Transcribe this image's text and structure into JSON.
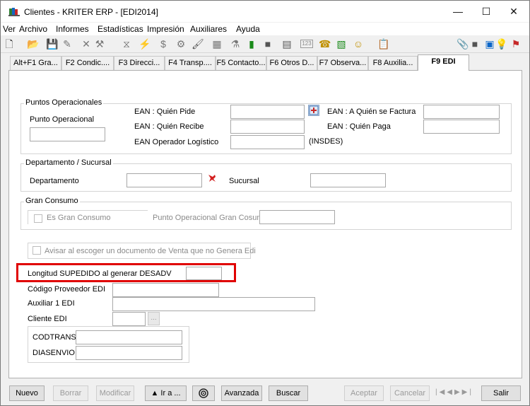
{
  "window": {
    "title": "Clientes - KRITER ERP - [EDI2014]",
    "min_glyph": "—",
    "max_glyph": "☐",
    "close_glyph": "✕"
  },
  "menu": [
    "Ver",
    "Archivo",
    "Informes",
    "Estadísticas",
    "Impresión",
    "Auxiliares",
    "Ayuda"
  ],
  "toolbar_icons": [
    {
      "name": "new-doc-icon",
      "glyph": "🗋"
    },
    {
      "name": "open-folder-icon",
      "glyph": "📂"
    },
    {
      "name": "save-icon",
      "glyph": "💾"
    },
    {
      "name": "edit-icon",
      "glyph": "✎"
    },
    {
      "name": "delete-x-icon",
      "glyph": "✕"
    },
    {
      "name": "hammer-icon",
      "glyph": "⚒"
    },
    {
      "name": "funnel-icon",
      "glyph": "⧖"
    },
    {
      "name": "wand-icon",
      "glyph": "⚡"
    },
    {
      "name": "dollar-icon",
      "glyph": "$"
    },
    {
      "name": "gear-icon",
      "glyph": "⚙"
    },
    {
      "name": "brush-icon",
      "glyph": "🖌"
    },
    {
      "name": "grid-icon",
      "glyph": "▦"
    },
    {
      "name": "filter-icon",
      "glyph": "⚗"
    },
    {
      "name": "bar-chart-icon",
      "glyph": "▮"
    },
    {
      "name": "dark-square-icon",
      "glyph": "■"
    },
    {
      "name": "calculator-icon",
      "glyph": "▤"
    },
    {
      "name": "counter-123-icon",
      "glyph": "123"
    },
    {
      "name": "phone-icon",
      "glyph": "☎"
    },
    {
      "name": "excel-icon",
      "glyph": "▧"
    },
    {
      "name": "smiley-icon",
      "glyph": "☺"
    },
    {
      "name": "clipboard-icon",
      "glyph": "📋"
    },
    {
      "name": "paperclip-icon",
      "glyph": "📎"
    },
    {
      "name": "blue-square-icon",
      "glyph": "■"
    },
    {
      "name": "layout-icon",
      "glyph": "▣"
    },
    {
      "name": "lightbulb-icon",
      "glyph": "💡"
    },
    {
      "name": "lock-icon",
      "glyph": "⚑"
    }
  ],
  "tabs": [
    "Alt+F1 Gra...",
    "F2 Condic....",
    "F3 Direcci...",
    "F4 Transp....",
    "F5 Contacto...",
    "F6 Otros D...",
    "F7 Observa...",
    "F8 Auxilia...",
    "F9 EDI"
  ],
  "puntos": {
    "group_title": "Puntos Operacionales",
    "punto_operacional_label": "Punto Operacional",
    "punto_operacional_value": "",
    "ean_pide_label": "EAN : Quién Pide",
    "ean_pide_value": "",
    "ean_recibe_label": "EAN : Quién Recibe",
    "ean_recibe_value": "",
    "ean_logistico_label": "EAN Operador Logístico",
    "ean_logistico_value": "",
    "insdes_label": "(INSDES)",
    "ean_factura_label": "EAN : A Quién se Factura",
    "ean_factura_value": "",
    "ean_paga_label": "EAN : Quién Paga",
    "ean_paga_value": ""
  },
  "departamento": {
    "group_title": "Departamento / Sucursal",
    "departamento_label": "Departamento",
    "departamento_value": "",
    "sucursal_label": "Sucursal",
    "sucursal_value": ""
  },
  "gran_consumo": {
    "group_title": "Gran Consumo",
    "checkbox_label": "Es Gran Consumo",
    "punto_label": "Punto Operacional Gran Cosumo",
    "punto_value": ""
  },
  "avisar": {
    "checkbox_label": "Avisar al escoger un documento de Venta que no Genera Edi"
  },
  "longitud": {
    "label": "Longitud SUPEDIDO al generar DESADV",
    "value": ""
  },
  "codigo_proveedor": {
    "label": "Código Proveedor EDI",
    "value": ""
  },
  "auxiliar1": {
    "label": "Auxiliar 1 EDI",
    "value": ""
  },
  "cliente_edi": {
    "label": "Cliente EDI",
    "value": "",
    "dots": "..."
  },
  "codtrans": {
    "label": "CODTRANS",
    "value": ""
  },
  "diasenvio": {
    "label": "DIASENVIO",
    "value": ""
  },
  "buttons": {
    "nuevo": "Nuevo",
    "borrar": "Borrar",
    "modificar": "Modificar",
    "ira": "▲ Ir a ...",
    "avanzada": "Avanzada",
    "buscar": "Buscar",
    "aceptar": "Aceptar",
    "cancelar": "Cancelar",
    "salir": "Salir",
    "nav_arrows": "|◀◀▶▶|"
  },
  "colors": {
    "highlight": "#e00000",
    "accent_blue": "#0b66c8"
  }
}
